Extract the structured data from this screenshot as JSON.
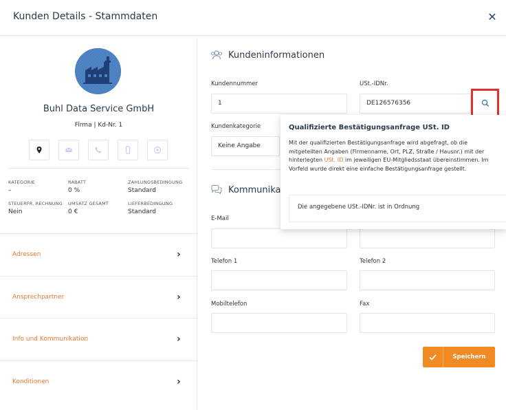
{
  "header": {
    "title": "Kunden Details - Stammdaten"
  },
  "profile": {
    "company_name": "Buhl Data Service GmbH",
    "subtitle": "Firma | Kd-Nr. 1",
    "action_icons": [
      "location-icon",
      "email-icon",
      "phone-icon",
      "mobile-icon",
      "web-icon"
    ]
  },
  "stats": [
    {
      "label": "KATEGORIE",
      "value": "–"
    },
    {
      "label": "RABATT",
      "value": "0 %"
    },
    {
      "label": "ZAHLUNGSBEDINGUNG",
      "value": "Standard"
    },
    {
      "label": "STEUERFR. RECHNUNG",
      "value": "Nein"
    },
    {
      "label": "UMSATZ GESAMT",
      "value": "0 €"
    },
    {
      "label": "LIEFERBEDINGUNG",
      "value": "Standard"
    }
  ],
  "nav": [
    {
      "label": "Adressen"
    },
    {
      "label": "Ansprechpartner"
    },
    {
      "label": "Info und Kommunikation"
    },
    {
      "label": "Konditionen"
    }
  ],
  "kundeninfo": {
    "title": "Kundeninformationen",
    "kundennummer_label": "Kundennummer",
    "kundennummer_value": "1",
    "ustid_label": "USt.-IDNr.",
    "ustid_value": "DE126576356",
    "kategorie_label": "Kundenkategorie",
    "kategorie_value": "Keine Angabe"
  },
  "kommunikation": {
    "title": "Kommunikat",
    "email_label": "E-Mail",
    "telefon1_label": "Telefon 1",
    "telefon2_label": "Telefon 2",
    "mobil_label": "Mobiltelefon",
    "fax_label": "Fax"
  },
  "popover": {
    "title": "Qualifizierte Bestätigungsanfrage USt. ID",
    "text_before": "Mit der qualifizierten Bestätigungsanfrage wird abgefragt, ob die mitgeteilten Angaben (Firmenname, Ort, PLZ, Straße / Hausnr.) mit der hinterlegten ",
    "text_link": "USt. ID",
    "text_after": " im jeweiligen EU-Mitgliedsstaat übereinstimmen. Im Vorfeld wurde direkt eine einfache Bestätigungsanfrage gestellt.",
    "result": "Die angegebene USt.-IDNr. ist in Ordnung"
  },
  "actions": {
    "save_label": "Speichern"
  },
  "colors": {
    "accent": "#f28a24",
    "link": "#e8772e",
    "highlight": "#e03030",
    "logo_bg": "#4a7fc0"
  }
}
